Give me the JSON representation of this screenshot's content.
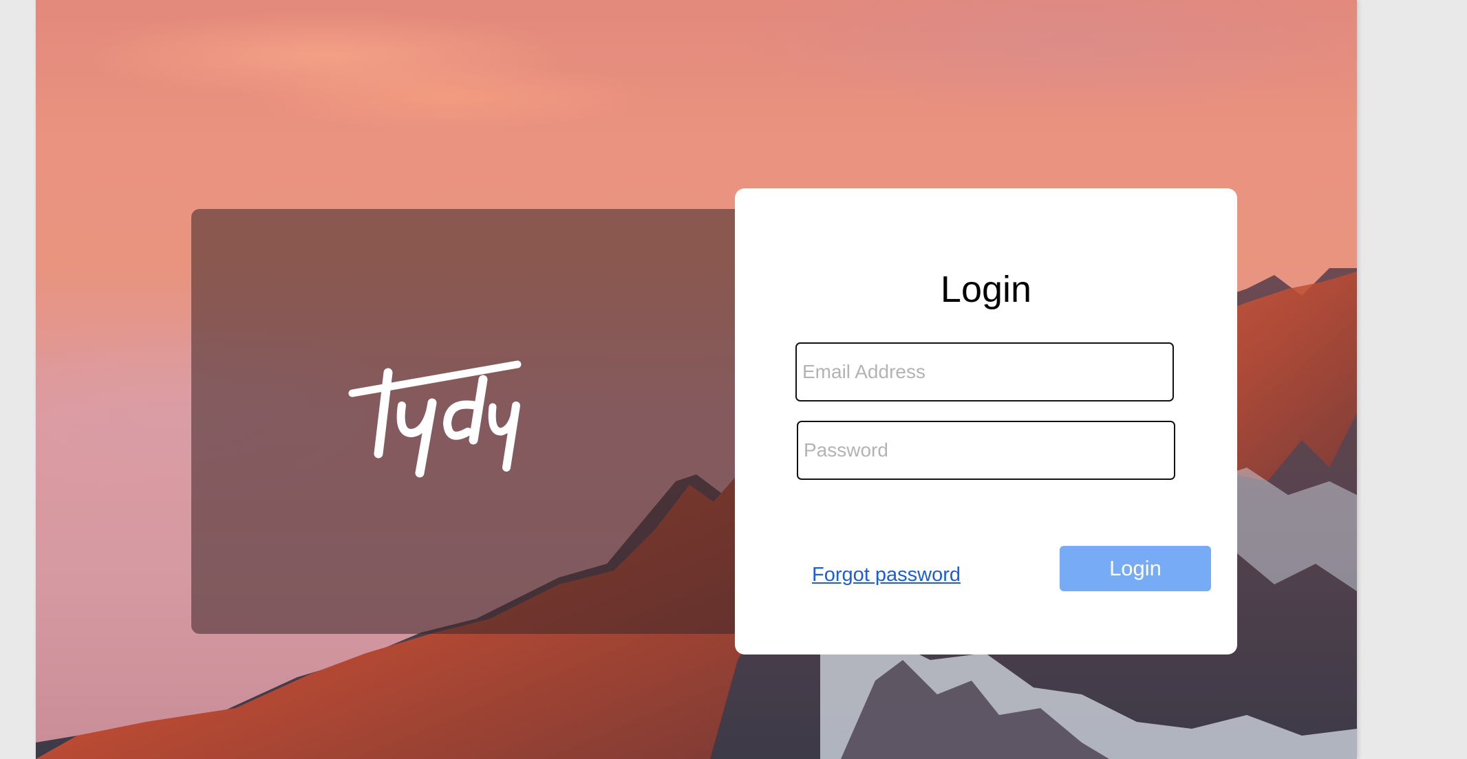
{
  "brand": {
    "logo_text": "tydy",
    "logo_icon": "tydy-logo-icon"
  },
  "login": {
    "title": "Login",
    "email_placeholder": "Email Address",
    "email_value": "",
    "password_placeholder": "Password",
    "password_value": "",
    "forgot_label": "Forgot password",
    "submit_label": "Login"
  },
  "colors": {
    "button": "#78abf6",
    "link": "#1a5fd6",
    "card": "#ffffff",
    "page_gutter": "#e9e9e9"
  }
}
